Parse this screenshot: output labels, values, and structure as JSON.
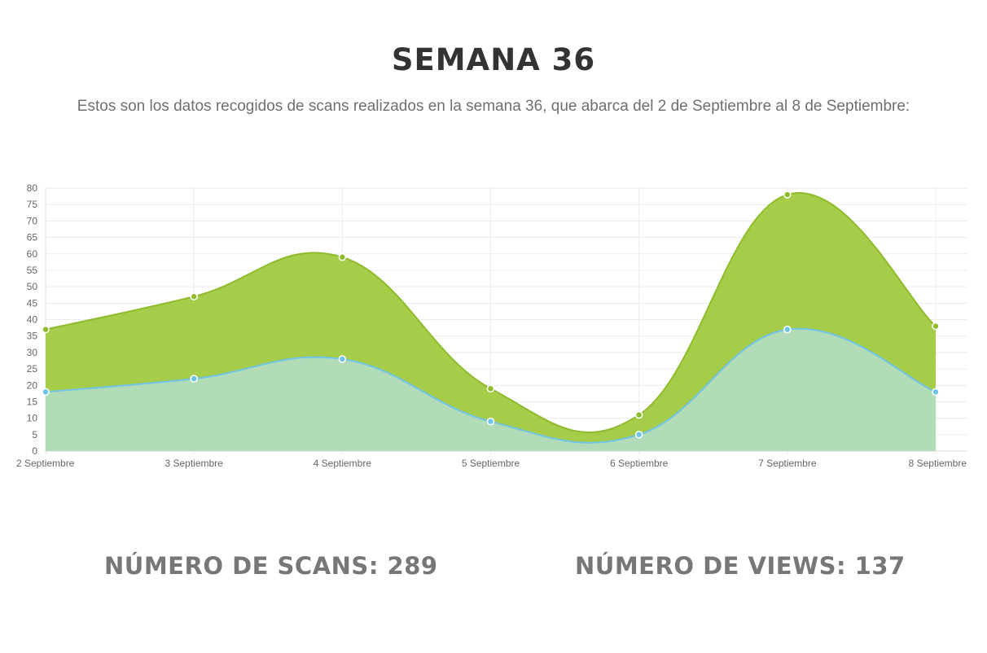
{
  "header": {
    "title": "SEMANA 36",
    "subtitle": "Estos son los datos recogidos de scans realizados en la semana 36, que abarca del 2 de Septiembre al 8 de Septiembre:"
  },
  "stats": {
    "scans_label": "NÚMERO DE SCANS:",
    "scans_value": "289",
    "views_label": "NÚMERO DE VIEWS:",
    "views_value": "137"
  },
  "colors": {
    "scans_fill": "#a6cd4a",
    "scans_line": "#8fbb2c",
    "views_fill": "#b2dbb7",
    "views_line": "#6ec3e6",
    "grid": "#ececec",
    "axis": "#dddddd"
  },
  "chart_data": {
    "type": "area",
    "categories": [
      "2 Septiembre",
      "3 Septiembre",
      "4 Septiembre",
      "5 Septiembre",
      "6 Septiembre",
      "7 Septiembre",
      "8 Septiembre"
    ],
    "series": [
      {
        "values": [
          37,
          47,
          59,
          19,
          11,
          78,
          38
        ]
      },
      {
        "values": [
          18,
          22,
          28,
          9,
          5,
          37,
          18
        ]
      }
    ],
    "ylim": [
      0,
      80
    ],
    "yticks": [
      0,
      5,
      10,
      15,
      20,
      25,
      30,
      35,
      40,
      45,
      50,
      55,
      60,
      65,
      70,
      75,
      80
    ],
    "grid": true,
    "xlabel": "",
    "ylabel": ""
  }
}
